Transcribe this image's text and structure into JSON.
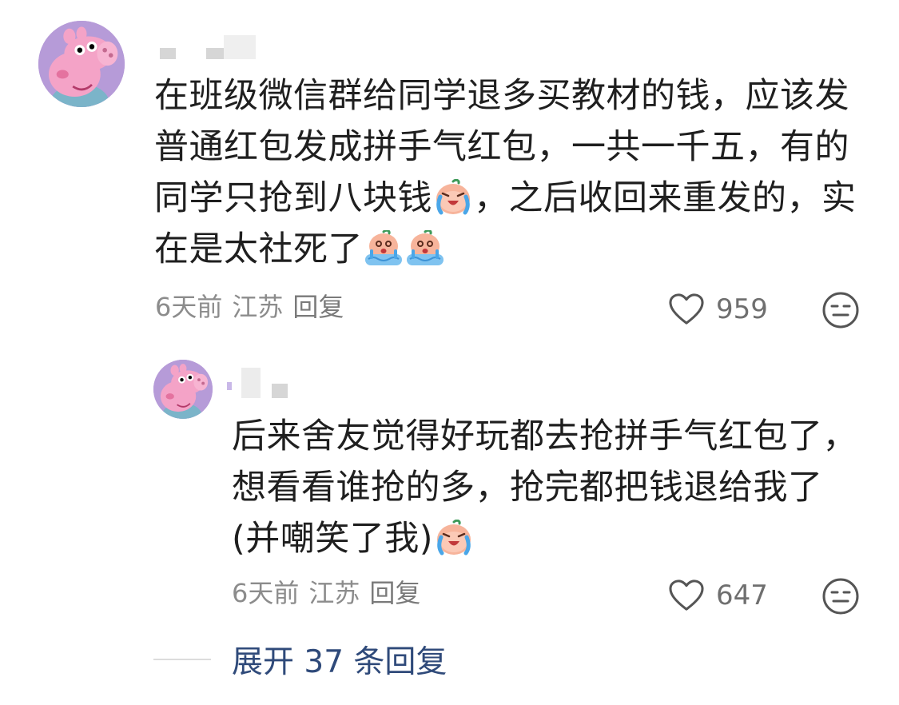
{
  "comments": [
    {
      "lines": [
        "在班级微信群给同学退多买教材的钱，应该发",
        "普通红包发成拼手气红包，一共一千五，有的",
        [
          "同学只抢到八块钱",
          "emoji:crying",
          "，之后收回来重发的，实"
        ],
        [
          "在是太社死了",
          "emoji:sob-tears",
          "emoji:sob-tears"
        ]
      ],
      "time": "6天前",
      "location": "江苏",
      "reply_label": "回复",
      "likes": "959"
    },
    {
      "lines": [
        "后来舍友觉得好玩都去抢拼手气红包了，",
        "想看看谁抢的多，抢完都把钱退给我了",
        [
          "(并嘲笑了我)",
          "emoji:crying"
        ]
      ],
      "time": "6天前",
      "location": "江苏",
      "reply_label": "回复",
      "likes": "647"
    }
  ],
  "expand_replies": "展开 37 条回复",
  "icons": {
    "avatar": "peppa-pig-avatar-icon",
    "like": "heart-outline-icon",
    "dislike": "neutral-face-icon",
    "emoji_crying": "crying-face-emoji",
    "emoji_sob": "sob-tears-emoji"
  },
  "colors": {
    "text": "#1f1f1f",
    "meta": "#8c8c8c",
    "link": "#2f4a7a",
    "avatar_bg": "#b69bd8",
    "peppa_pink": "#f4a3c7"
  }
}
